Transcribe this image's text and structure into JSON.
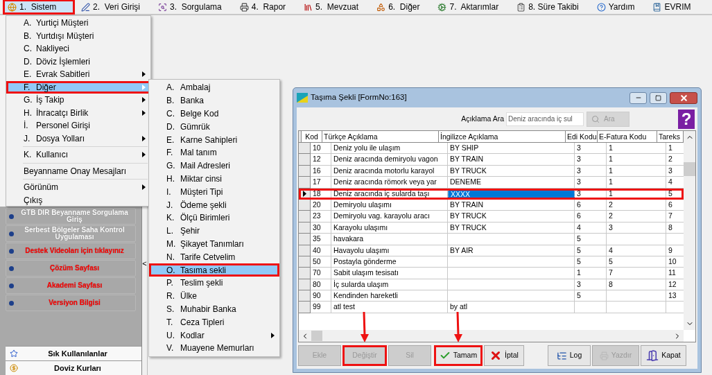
{
  "menubar": [
    {
      "label": "1.  Sistem",
      "selected": true,
      "highlighted": true
    },
    {
      "label": "2.  Veri Girişi",
      "selected": false,
      "highlighted": false
    },
    {
      "label": "3.  Sorgulama",
      "selected": false,
      "highlighted": false
    },
    {
      "label": "4.  Rapor",
      "selected": false,
      "highlighted": false
    },
    {
      "label": "5.  Mevzuat",
      "selected": false,
      "highlighted": false
    },
    {
      "label": "6.  Diğer",
      "selected": false,
      "highlighted": false
    },
    {
      "label": "7.  Aktarımlar",
      "selected": false,
      "highlighted": false
    },
    {
      "label": "8. Süre Takibi",
      "selected": false,
      "highlighted": false
    },
    {
      "label": "Yardım",
      "selected": false,
      "highlighted": false
    },
    {
      "label": "EVRIM",
      "selected": false,
      "highlighted": false
    }
  ],
  "sistem_menu": [
    {
      "key": "A.",
      "label": "Yurtiçi Müşteri",
      "selected": false,
      "highlighted": false
    },
    {
      "key": "B.",
      "label": "Yurtdışı Müşteri",
      "selected": false,
      "highlighted": false
    },
    {
      "key": "C.",
      "label": "Nakliyeci",
      "selected": false,
      "highlighted": false
    },
    {
      "key": "D.",
      "label": "Döviz İşlemleri",
      "selected": false,
      "highlighted": false
    },
    {
      "key": "E.",
      "label": "Evrak Sabitleri",
      "submenu": true,
      "selected": false,
      "highlighted": false
    },
    {
      "key": "F.",
      "label": "Diğer",
      "submenu": true,
      "selected": true,
      "highlighted": true
    },
    {
      "key": "G.",
      "label": "İş Takip",
      "submenu": true,
      "selected": false,
      "highlighted": false
    },
    {
      "key": "H.",
      "label": "İhracatçı Birlik",
      "submenu": true,
      "selected": false,
      "highlighted": false
    },
    {
      "key": "İ.",
      "label": "Personel Girişi",
      "selected": false,
      "highlighted": false
    },
    {
      "key": "J.",
      "label": "Dosya Yolları",
      "submenu": true,
      "selected": false,
      "highlighted": false
    },
    {
      "key": "K.",
      "label": "Kullanıcı",
      "submenu": true,
      "selected": false,
      "highlighted": false,
      "separator_before": true
    },
    {
      "label": "Beyanname Onay Mesajları",
      "selected": false,
      "highlighted": false,
      "separator_before": true
    },
    {
      "label": "Görünüm",
      "submenu": true,
      "selected": false,
      "highlighted": false,
      "separator_before": true
    },
    {
      "label": "Çıkış",
      "selected": false,
      "highlighted": false
    }
  ],
  "diger_menu": [
    {
      "key": "A.",
      "label": "Ambalaj",
      "selected": false,
      "highlighted": false
    },
    {
      "key": "B.",
      "label": "Banka",
      "selected": false,
      "highlighted": false
    },
    {
      "key": "C.",
      "label": "Belge Kod",
      "selected": false,
      "highlighted": false
    },
    {
      "key": "D.",
      "label": "Gümrük",
      "selected": false,
      "highlighted": false
    },
    {
      "key": "E.",
      "label": "Karne Sahipleri",
      "selected": false,
      "highlighted": false
    },
    {
      "key": "F.",
      "label": "Mal tanım",
      "selected": false,
      "highlighted": false
    },
    {
      "key": "G.",
      "label": "Mail Adresleri",
      "selected": false,
      "highlighted": false
    },
    {
      "key": "H.",
      "label": "Miktar cinsi",
      "selected": false,
      "highlighted": false
    },
    {
      "key": "I.",
      "label": "Müşteri Tipi",
      "selected": false,
      "highlighted": false
    },
    {
      "key": "J.",
      "label": "Ödeme şekli",
      "selected": false,
      "highlighted": false
    },
    {
      "key": "K.",
      "label": "Ölçü Birimleri",
      "selected": false,
      "highlighted": false
    },
    {
      "key": "L.",
      "label": "Şehir",
      "selected": false,
      "highlighted": false
    },
    {
      "key": "M.",
      "label": "Şikayet Tanımları",
      "selected": false,
      "highlighted": false
    },
    {
      "key": "N.",
      "label": "Tarife Cetvelim",
      "selected": false,
      "highlighted": false
    },
    {
      "key": "O.",
      "label": "Tasıma sekli",
      "selected": true,
      "highlighted": true
    },
    {
      "key": "P.",
      "label": "Teslim şekli",
      "selected": false,
      "highlighted": false
    },
    {
      "key": "R.",
      "label": "Ülke",
      "selected": false,
      "highlighted": false
    },
    {
      "key": "S.",
      "label": "Muhabir Banka",
      "selected": false,
      "highlighted": false
    },
    {
      "key": "T.",
      "label": "Ceza Tipleri",
      "selected": false,
      "highlighted": false
    },
    {
      "key": "U.",
      "label": "Kodlar",
      "submenu": true,
      "selected": false,
      "highlighted": false
    },
    {
      "key": "V.",
      "label": "Muayene Memurları",
      "selected": false,
      "highlighted": false
    }
  ],
  "sidebar": {
    "links": [
      {
        "label": "GTB DIR Beyanname Sorgulama Giriş",
        "color": "#ffffff"
      },
      {
        "label": "Serbest Bölgeler Saha Kontrol Uygulaması",
        "color": "#ffffff"
      },
      {
        "label": "Destek Videoları için tıklayınız",
        "color": "#ff0000"
      },
      {
        "label": "Çözüm Sayfası",
        "color": "#ff0000"
      },
      {
        "label": "Akademi Sayfası",
        "color": "#ff0000"
      },
      {
        "label": "Versiyon Bilgisi",
        "color": "#ff0000"
      }
    ],
    "panels": [
      "Sık Kullanılanlar",
      "Doviz Kurları"
    ],
    "collapse": "<"
  },
  "window": {
    "title": "Taşıma Şekli [FormNo:163]",
    "search": {
      "label": "Açıklama Ara",
      "value": "Deniz aracında iç sul",
      "button": "Ara",
      "button_disabled": true
    },
    "help": "?",
    "table": {
      "columns": [
        "Kod",
        "Türkçe Açıklama",
        "İngilizce Açıklama",
        "Edi Kodu",
        "E-Fatura Kodu",
        "Tareks"
      ],
      "rows": [
        {
          "cells": [
            "10",
            "Deniz yolu ile ulaşım",
            "BY SHIP",
            "3",
            "1",
            "1"
          ],
          "selected": false
        },
        {
          "cells": [
            "12",
            "Deniz aracında demiryolu vagon",
            "BY TRAIN",
            "3",
            "1",
            "2"
          ],
          "selected": false
        },
        {
          "cells": [
            "16",
            "Deniz aracında motorlu karayol",
            "BY TRUCK",
            "3",
            "1",
            "3"
          ],
          "selected": false
        },
        {
          "cells": [
            "17",
            "Deniz aracında römork veya yar",
            "DENEME",
            "3",
            "1",
            "4"
          ],
          "selected": false
        },
        {
          "cells": [
            "18",
            "Deniz aracında iç sularda taşı",
            "XXXX",
            "3",
            "1",
            "5"
          ],
          "selected": true,
          "highlighted": true
        },
        {
          "cells": [
            "20",
            "Demiryolu ulaşımı",
            "BY TRAIN",
            "6",
            "2",
            "6"
          ],
          "selected": false
        },
        {
          "cells": [
            "23",
            "Demiryolu vag. karayolu aracı",
            "BY TRUCK",
            "6",
            "2",
            "7"
          ],
          "selected": false
        },
        {
          "cells": [
            "30",
            "Karayolu ulaşımı",
            "BY TRUCK",
            "4",
            "3",
            "8"
          ],
          "selected": false
        },
        {
          "cells": [
            "35",
            "havakara",
            "",
            "5",
            "",
            ""
          ],
          "selected": false
        },
        {
          "cells": [
            "40",
            "Havayolu ulaşımı",
            "BY AIR",
            "5",
            "4",
            "9"
          ],
          "selected": false
        },
        {
          "cells": [
            "50",
            "Postayla gönderme",
            "",
            "5",
            "5",
            "10"
          ],
          "selected": false
        },
        {
          "cells": [
            "70",
            "Sabit ulaşım tesisatı",
            "",
            "1",
            "7",
            "11"
          ],
          "selected": false
        },
        {
          "cells": [
            "80",
            "İç sularda ulaşım",
            "",
            "3",
            "8",
            "12"
          ],
          "selected": false
        },
        {
          "cells": [
            "90",
            "Kendinden hareketli",
            "",
            "5",
            "",
            "13"
          ],
          "selected": false
        },
        {
          "cells": [
            "99",
            "atl test",
            "by atl",
            "",
            "",
            ""
          ],
          "selected": false
        }
      ]
    },
    "buttons": [
      {
        "kind": "plain",
        "label": "Ekle",
        "disabled": true,
        "highlighted": false,
        "arrow": false
      },
      {
        "kind": "plain",
        "label": "Değiştir",
        "disabled": true,
        "highlighted": true,
        "arrow": true
      },
      {
        "kind": "plain",
        "label": "Sil",
        "disabled": true,
        "highlighted": false,
        "arrow": false
      },
      {
        "kind": "ok",
        "label": "Tamam",
        "disabled": false,
        "highlighted": true,
        "arrow": true
      },
      {
        "kind": "cancel",
        "label": "İptal",
        "disabled": false,
        "highlighted": false,
        "arrow": false
      },
      {
        "kind": "log",
        "label": "Log",
        "disabled": false,
        "highlighted": false,
        "arrow": false
      },
      {
        "kind": "print",
        "label": "Yazdır",
        "disabled": true,
        "highlighted": false,
        "arrow": false
      },
      {
        "kind": "close",
        "label": "Kapat",
        "disabled": false,
        "highlighted": false,
        "arrow": false
      }
    ]
  }
}
